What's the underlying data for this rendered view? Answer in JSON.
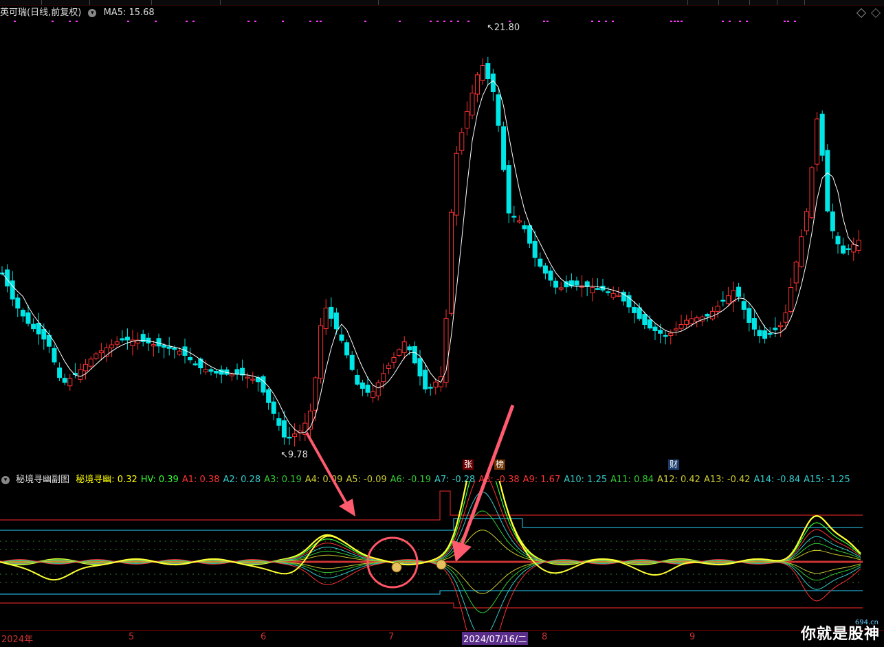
{
  "header": {
    "stock_name": "英可瑞",
    "period_label": "(日线,前复权)",
    "ma_label": "MA5: 15.68"
  },
  "price_annotations": {
    "high": "21.80",
    "low": "9.78"
  },
  "events": [
    "张",
    "榜",
    "财"
  ],
  "indicator": {
    "panel_title": "秘境寻幽副图",
    "items": [
      {
        "label": "秘境寻幽: 0.32",
        "color": "#ffff00"
      },
      {
        "label": "HV: 0.39",
        "color": "#33ff33"
      },
      {
        "label": "A1: 0.38",
        "color": "#ff3333"
      },
      {
        "label": "A2: 0.28",
        "color": "#33cccc"
      },
      {
        "label": "A3: 0.19",
        "color": "#33cc33"
      },
      {
        "label": "A4: 0.09",
        "color": "#cccc33"
      },
      {
        "label": "A5: -0.09",
        "color": "#cccc33"
      },
      {
        "label": "A6: -0.19",
        "color": "#33cc33"
      },
      {
        "label": "A7: -0.28",
        "color": "#33cccc"
      },
      {
        "label": "A8: -0.38",
        "color": "#ff3333"
      },
      {
        "label": "A9: 1.67",
        "color": "#ff3333"
      },
      {
        "label": "A10: 1.25",
        "color": "#33cccc"
      },
      {
        "label": "A11: 0.84",
        "color": "#33cc33"
      },
      {
        "label": "A12: 0.42",
        "color": "#cccc33"
      },
      {
        "label": "A13: -0.42",
        "color": "#cccc33"
      },
      {
        "label": "A14: -0.84",
        "color": "#33cccc"
      },
      {
        "label": "A15: -1.25",
        "color": "#33cccc"
      }
    ]
  },
  "time_axis": [
    "2024年",
    "5",
    "6",
    "7",
    "2024/07/16/二",
    "8",
    "9"
  ],
  "watermark": {
    "site": "694.cn",
    "text": "你就是股神"
  },
  "colors": {
    "up": "#ff3232",
    "down": "#00e5e5",
    "ma": "#ffffff",
    "bg": "#000000"
  }
}
